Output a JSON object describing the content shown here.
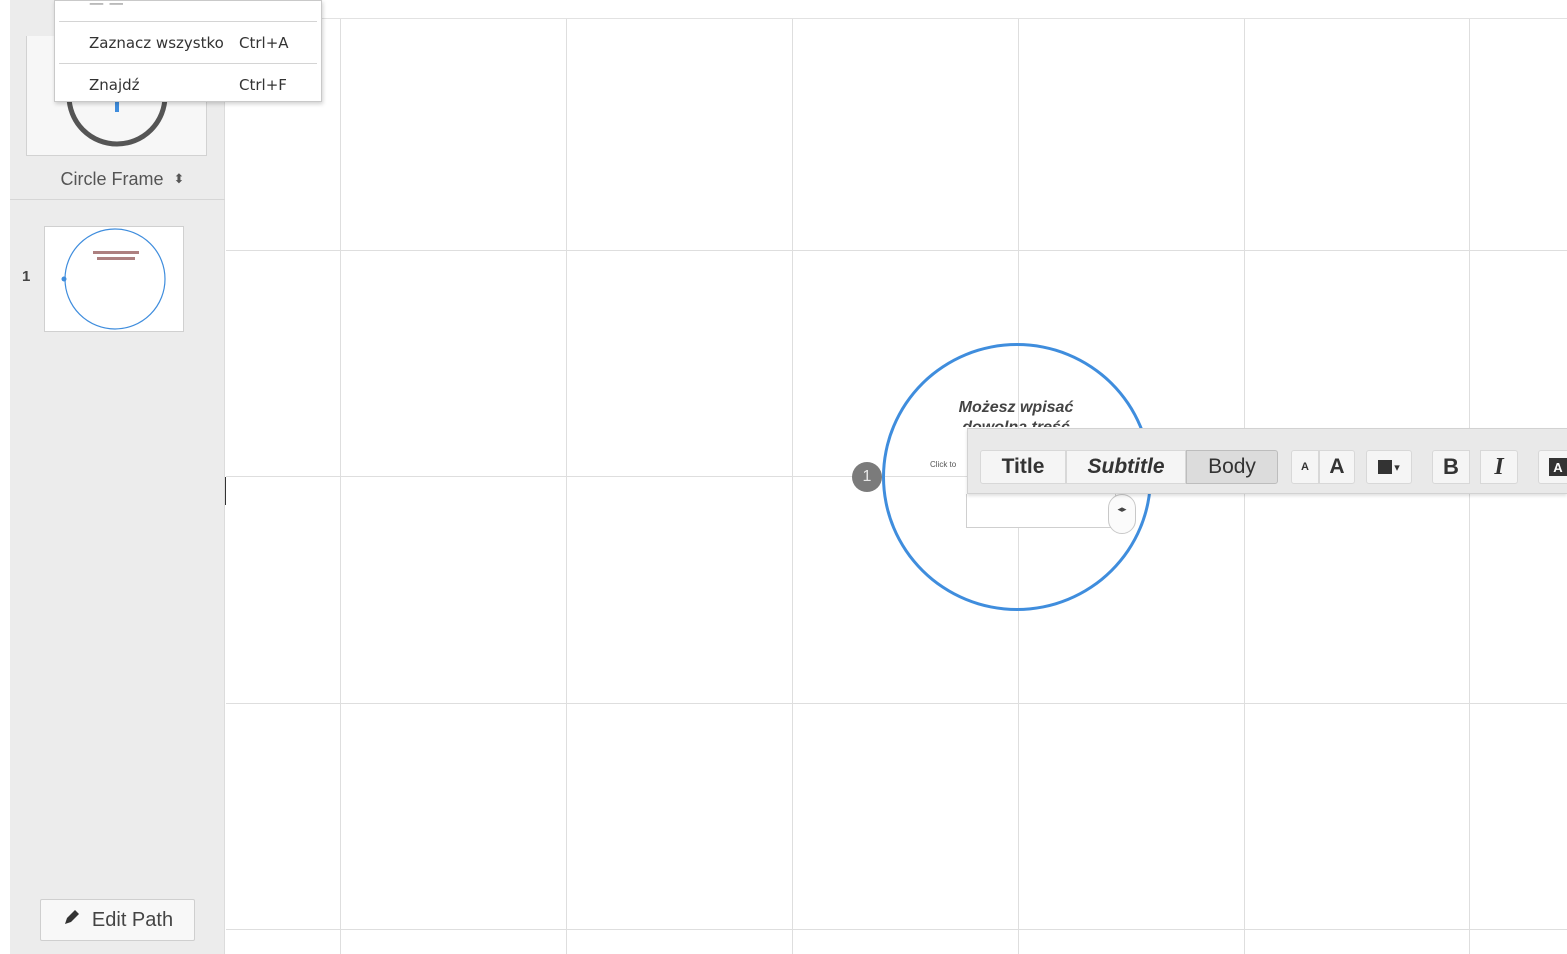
{
  "context_menu": {
    "items": [
      {
        "label": "Zaznacz wszystko",
        "shortcut": "Ctrl+A"
      },
      {
        "label": "Znajdź",
        "shortcut": "Ctrl+F"
      }
    ]
  },
  "sidebar": {
    "frame_selector_label": "Circle Frame",
    "frame_selector_arrow": "⬍",
    "slides": [
      {
        "number": "1"
      }
    ],
    "edit_path_label": "Edit Path",
    "edit_path_icon": "pencil-icon"
  },
  "canvas": {
    "frame": {
      "title_line1": "Możesz wpisać",
      "title_line2": "dowolną treść",
      "click_hint": "Click to",
      "path_number": "1",
      "accent_color": "#3f8ddd"
    }
  },
  "text_toolbar": {
    "style_title": "Title",
    "style_subtitle": "Subtitle",
    "style_body": "Body",
    "selected_style": "Body",
    "size_small": "A",
    "size_large": "A",
    "color_caret": "▾",
    "bold": "B",
    "italic": "I",
    "highlight": "A"
  }
}
